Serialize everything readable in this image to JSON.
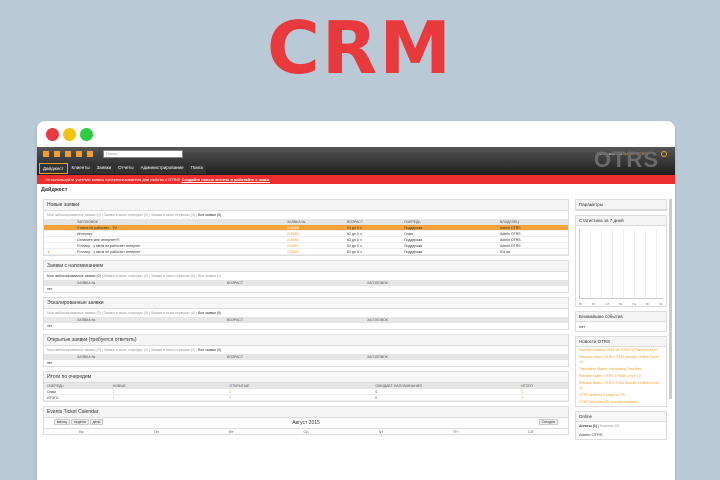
{
  "banner": {
    "title": "CRM"
  },
  "app": {
    "search_placeholder": "Поиск",
    "logged_in_text": "Вы вошли как",
    "logged_in_user": "Admin OTRS",
    "logo": "OTRS",
    "menu": [
      "Дайджест",
      "Клиенты",
      "Заявки",
      "Отчеты",
      "Администрирование",
      "Поиск"
    ],
    "alert_prefix": "Не используйте учетную запись суперпользователя для работы с OTRS!",
    "alert_link": "Создайте новые агенты и работайте с ними.",
    "page_title": "Дайджест"
  },
  "new_tickets": {
    "title": "Новые заявки",
    "filters": [
      "Мои заблокированные заявки (0)",
      "Заявки в моих очередях (0)",
      "Заявки в моих сервисах (0)",
      "Все заявки (5)"
    ],
    "columns": [
      "",
      "ЗАГОЛОВОК",
      "ЗАЯВКА №",
      "ВОЗРАСТ",
      "ОЧЕРЕДЬ",
      "ВЛАДЕЛЕЦ"
    ],
    "rows": [
      {
        "flag": "",
        "title": "У меня не работает... TV",
        "number": "215588",
        "age": "62 дн 0 ч",
        "queue": "Поддержка",
        "owner": "Admin OTRS"
      },
      {
        "flag": "",
        "title": "Интернет",
        "number": "215589",
        "age": "62 дн 0 ч",
        "queue": "Спам",
        "owner": "Admin OTRS"
      },
      {
        "flag": "",
        "title": "Оплатите мне интернет!!!!",
        "number": "215590",
        "age": "62 дн 0 ч",
        "queue": "Поддержка",
        "owner": "Admin OTRS"
      },
      {
        "flag": "",
        "title": "Я плачу... у меня не работает интернет",
        "number": "215591",
        "age": "62 дн 0 ч",
        "queue": "Поддержка",
        "owner": "Admin OTRS"
      },
      {
        "flag": "★",
        "title": "Я плачу... у меня не работает интернет",
        "number": "215592",
        "age": "62 дн 0 ч",
        "queue": "Поддержка",
        "owner": "Юз ва"
      }
    ]
  },
  "reminder_tickets": {
    "title": "Заявки с напоминанием",
    "filters": [
      "Мои заблокированные заявки (0)",
      "Заявки в моих очередях (0)",
      "Заявки в моих сервисах (0)",
      "Все заявки (0)"
    ],
    "columns": [
      "",
      "ЗАЯВКА №",
      "ВОЗРАСТ",
      "ЗАГОЛОВОК"
    ],
    "empty": "нет"
  },
  "escalated_tickets": {
    "title": "Эскалированные заявки",
    "filters": [
      "Мои заблокированные заявки (0)",
      "Заявки в моих очередях (0)",
      "Заявки в моих сервисах (0)",
      "Все заявки (0)"
    ],
    "columns": [
      "",
      "ЗАЯВКА №",
      "ВОЗРАСТ",
      "ЗАГОЛОВОК"
    ],
    "empty": "нет"
  },
  "open_tickets": {
    "title": "Открытые заявки (требуется ответить)",
    "filters": [
      "Мои заблокированные заявки (0)",
      "Заявки в моих очередях (0)",
      "Заявки в моих сервисах (0)",
      "Все заявки (0)"
    ],
    "columns": [
      "",
      "ЗАЯВКА №",
      "ВОЗРАСТ",
      "ЗАГОЛОВОК"
    ],
    "empty": "нет"
  },
  "queue_totals": {
    "title": "Итоги по очередям",
    "columns": [
      "ОЧЕРЕДЬ",
      "НОВЫЕ",
      "ОТКРЫТЫЕ",
      "ОЖИДАЕТ НАПОМИНАНИЯ",
      "ИТОГО"
    ],
    "rows": [
      {
        "queue": "Спам",
        "new": "1",
        "open": "0",
        "pending": "0",
        "total": "1"
      },
      {
        "queue": "ИТОГО",
        "new": "1",
        "open": "0",
        "pending": "0",
        "total": "1"
      }
    ]
  },
  "calendar": {
    "title": "Events Ticket Calendar",
    "buttons": [
      "месяц",
      "неделя",
      "день"
    ],
    "month": "Август 2015",
    "today": "Сегодня",
    "days": [
      "Вс",
      "Пн",
      "Вт",
      "Ср",
      "Чт",
      "Пт",
      "Сб"
    ]
  },
  "sidebar": {
    "options": "Параметры",
    "stats_title": "Статистика за 7 дней",
    "stats_days": [
      "Вт",
      "Пт",
      "Сб",
      "Вс",
      "Пн",
      "Вт",
      "Ср"
    ],
    "events_title": "Ближайшие события",
    "events_empty": "нет",
    "news_title": "Новости OTRS",
    "news_items": [
      "Security Advisory 2015-01 OTRS 4 Patch Level 10",
      "Release Notes: OTRS::ITSM Module 4 Patch Level 10",
      "Translation Status: Introducing Transifex",
      "Release Notes: OTRS 4 Patch Level 10",
      "Release Notes: OTRS::ITSM Module 4 Patch Level 10",
      "OTRS reaches 6 years of ITIL",
      "OTRS specifies ITIL process software"
    ],
    "online_title": "Online",
    "online_tabs": [
      "Агенты (1)",
      "Клиенты (0)"
    ],
    "online_user": "Admin OTRS"
  }
}
